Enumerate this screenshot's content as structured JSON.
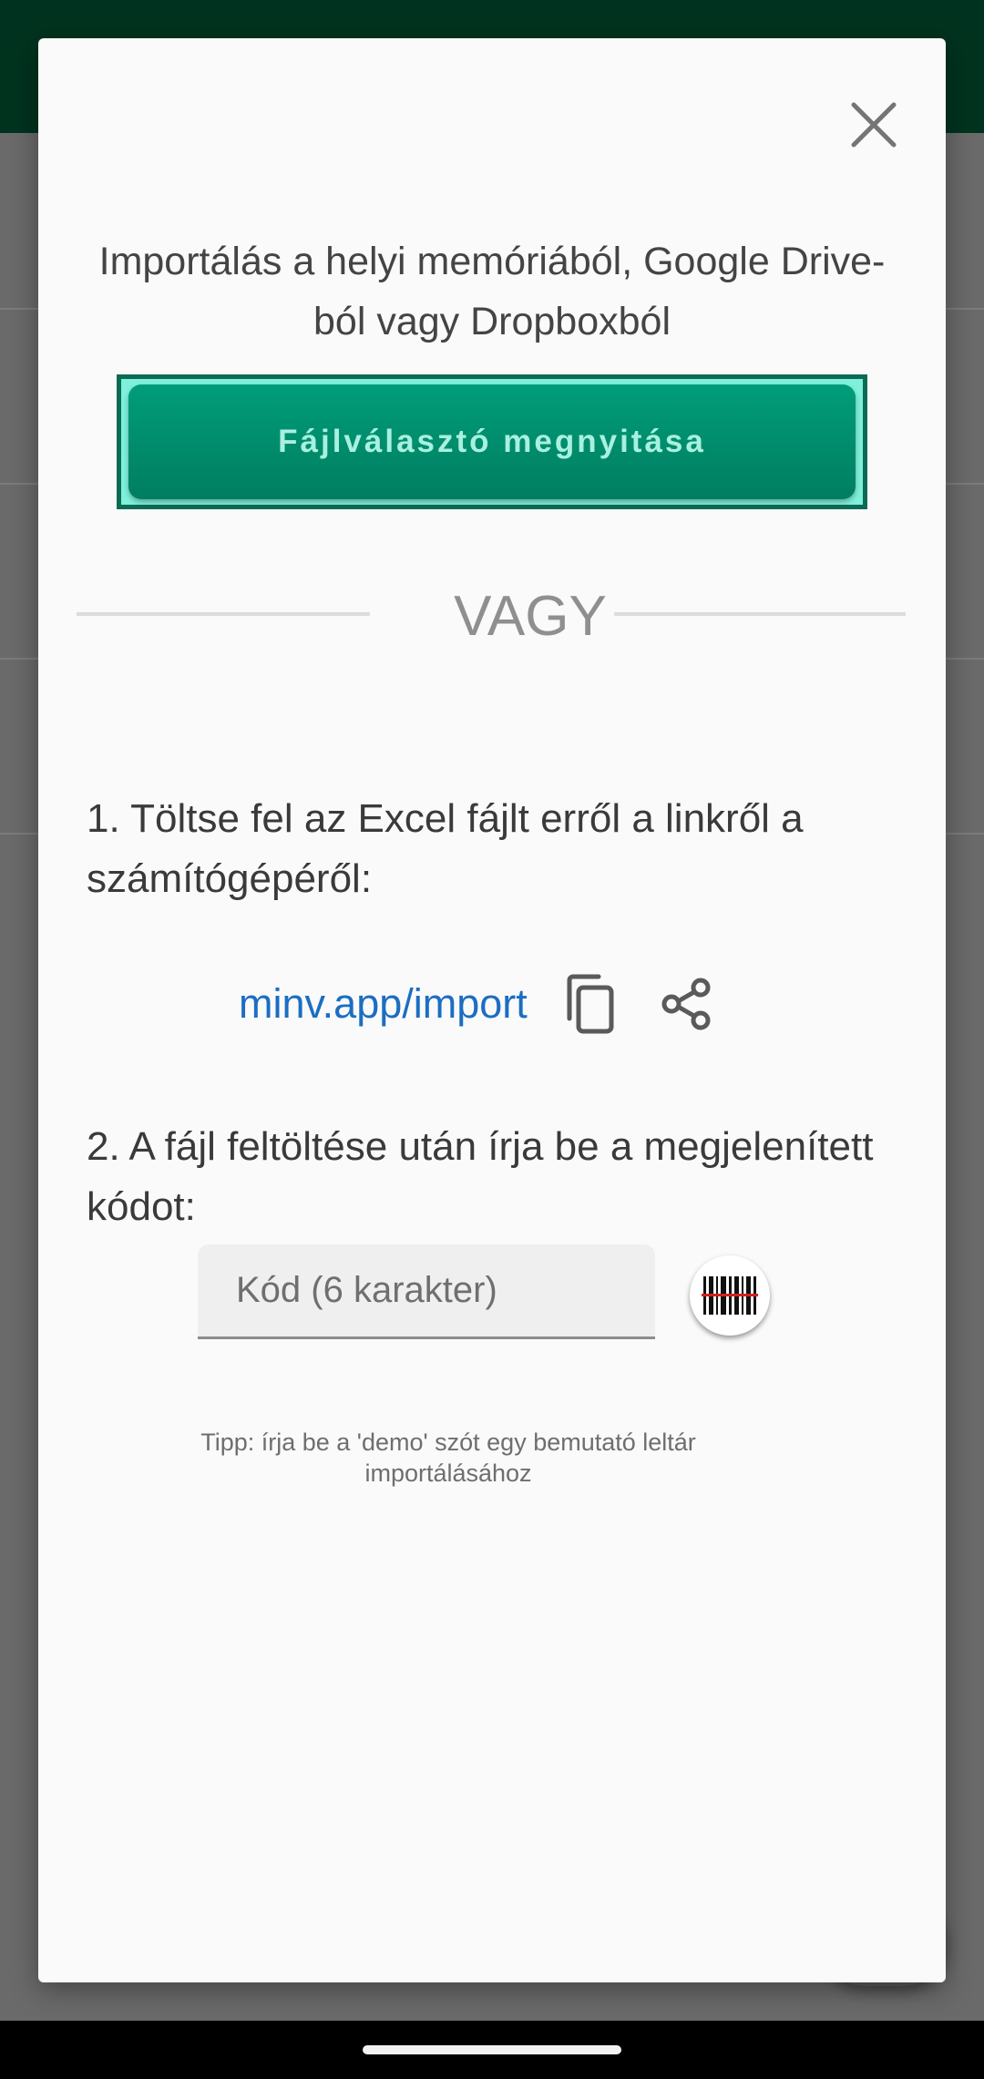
{
  "dialog": {
    "title": "Importálás a helyi memóriából, Google Drive-ból vagy Dropboxból",
    "file_picker_label": "Fájlválasztó megnyitása",
    "divider": "VAGY",
    "step1": "1. Töltse fel az Excel fájlt erről a linkről a számítógépéről:",
    "link": "minv.app/import",
    "step2": "2. A fájl feltöltése után írja be a megjelenített kódot:",
    "code_placeholder": "Kód (6 karakter)",
    "hint": "Tipp: írja be a 'demo' szót egy bemutató leltár importálásához"
  },
  "icons": {
    "close": "close-icon",
    "copy": "copy-icon",
    "share": "share-icon",
    "barcode": "barcode-scan-icon"
  },
  "colors": {
    "accent": "#008a69",
    "link": "#1b6ec2",
    "topbar": "#00331f"
  }
}
